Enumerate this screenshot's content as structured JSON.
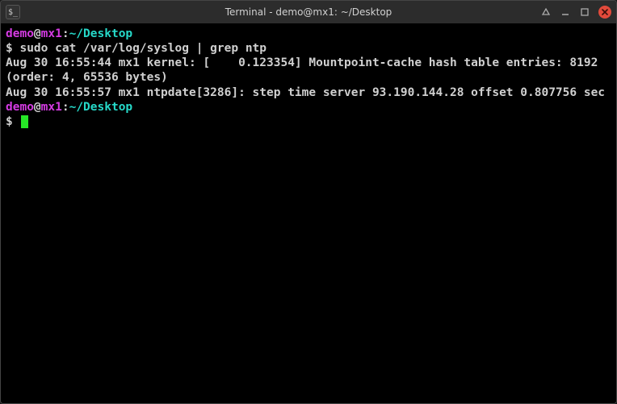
{
  "window": {
    "title": "Terminal - demo@mx1: ~/Desktop",
    "app_icon_text": "$_"
  },
  "prompt1": {
    "user": "demo",
    "at": "@",
    "host": "mx1",
    "colon": ":",
    "path": "~/Desktop"
  },
  "cmd1": {
    "dollar": "$ ",
    "text": "sudo cat /var/log/syslog | grep ntp"
  },
  "output": {
    "line1": "Aug 30 16:55:44 mx1 kernel: [    0.123354] Mountpoint-cache hash table entries: 8192 (order: 4, 65536 bytes)",
    "line2": "Aug 30 16:55:57 mx1 ntpdate[3286]: step time server 93.190.144.28 offset 0.807756 sec"
  },
  "prompt2": {
    "user": "demo",
    "at": "@",
    "host": "mx1",
    "colon": ":",
    "path": "~/Desktop"
  },
  "cmd2": {
    "dollar": "$ "
  }
}
